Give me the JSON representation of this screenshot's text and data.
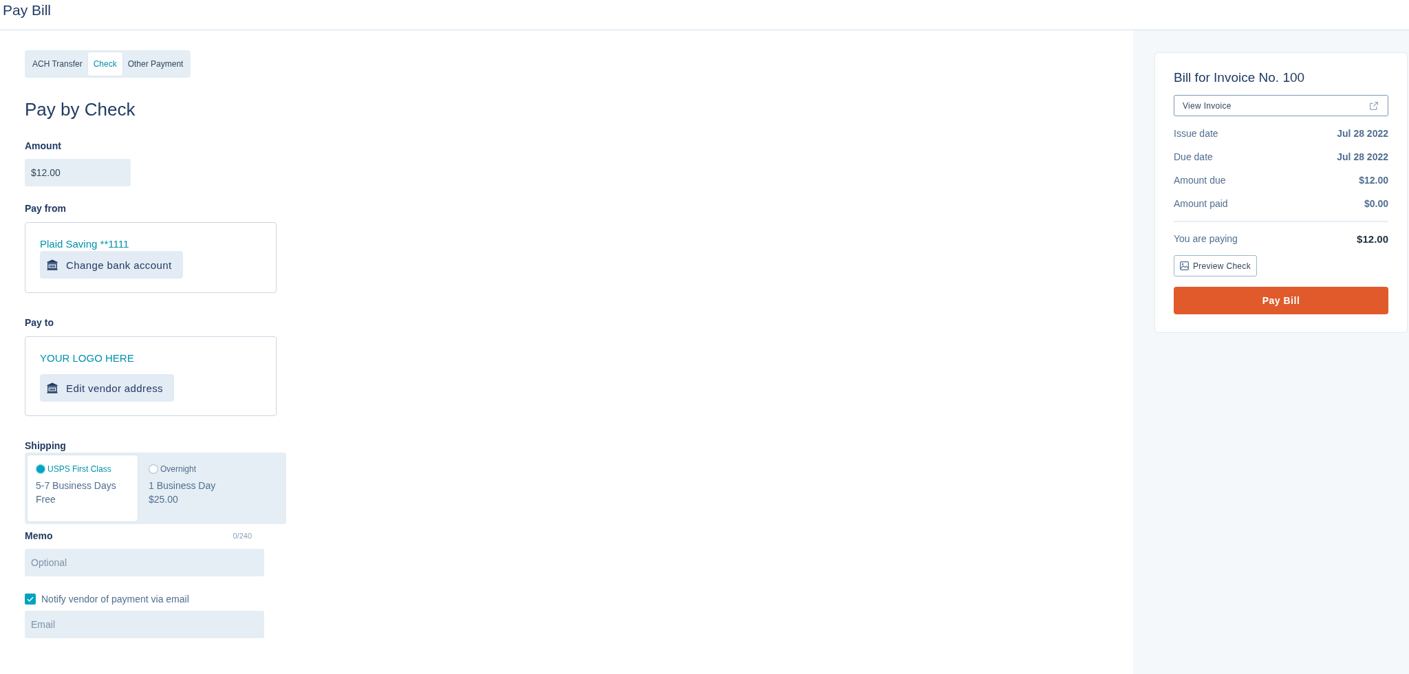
{
  "page": {
    "title": "Pay Bill"
  },
  "payment_tabs": [
    {
      "label": "ACH Transfer",
      "selected": false
    },
    {
      "label": "Check",
      "selected": true
    },
    {
      "label": "Other Payment",
      "selected": false
    }
  ],
  "form": {
    "heading": "Pay by Check",
    "amount": {
      "label": "Amount",
      "value": "$12.00"
    },
    "pay_from": {
      "label": "Pay from",
      "account": "Plaid Saving **1111",
      "button": "Change bank account"
    },
    "pay_to": {
      "label": "Pay to",
      "vendor": "YOUR LOGO HERE",
      "button": "Edit vendor address"
    },
    "shipping": {
      "label": "Shipping",
      "options": [
        {
          "name": "USPS First Class",
          "time": "5-7 Business Days",
          "price": "Free",
          "selected": true
        },
        {
          "name": "Overnight",
          "time": "1 Business Day",
          "price": "$25.00",
          "selected": false
        }
      ]
    },
    "memo": {
      "label": "Memo",
      "counter": "0/240",
      "placeholder": "Optional"
    },
    "notify": {
      "label": "Notify vendor of payment via email",
      "checked": true
    },
    "email": {
      "placeholder": "Email"
    }
  },
  "summary": {
    "title": "Bill for Invoice No. 100",
    "view_button": "View Invoice",
    "rows": [
      {
        "label": "Issue date",
        "value": "Jul 28 2022"
      },
      {
        "label": "Due date",
        "value": "Jul 28 2022"
      },
      {
        "label": "Amount due",
        "value": "$12.00"
      },
      {
        "label": "Amount paid",
        "value": "$0.00"
      }
    ],
    "total": {
      "label": "You are paying",
      "value": "$12.00"
    },
    "preview_button": "Preview Check",
    "pay_button": "Pay Bill"
  }
}
